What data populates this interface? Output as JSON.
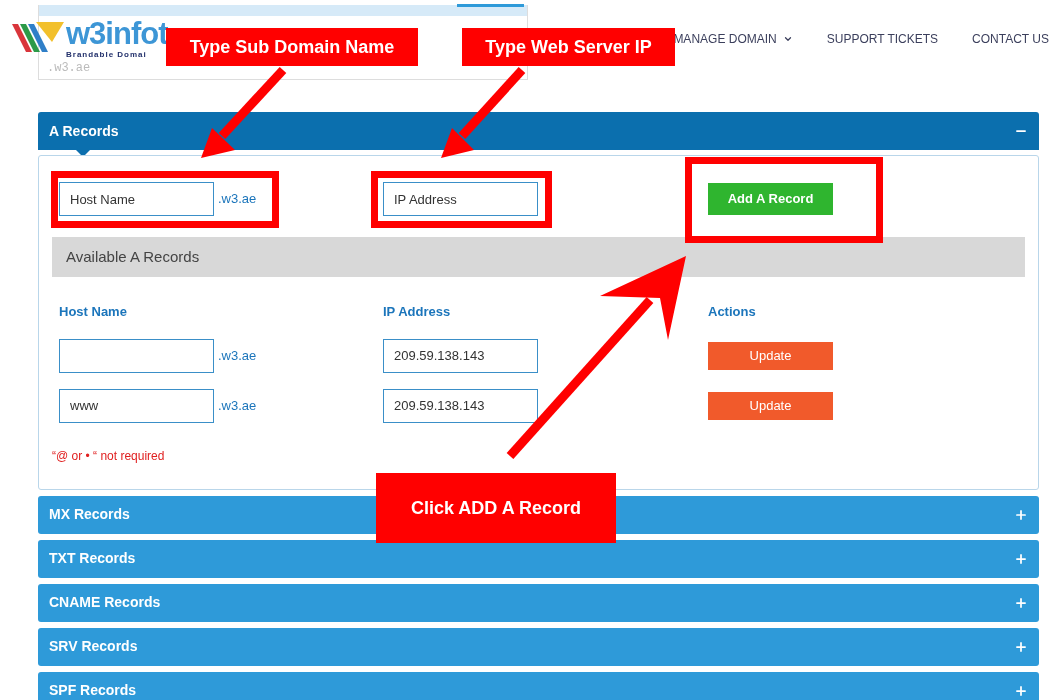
{
  "background_table": {
    "row": ".w3.ae"
  },
  "logo": {
    "name": "w3infot",
    "tagline": "Brandable Domai"
  },
  "nav": [
    {
      "label": "MANAGE DOMAIN",
      "has_menu": true
    },
    {
      "label": "SUPPORT TICKETS",
      "has_menu": false
    },
    {
      "label": "CONTACT US",
      "has_menu": false
    }
  ],
  "sections": [
    {
      "title": "A Records",
      "expanded": true
    },
    {
      "title": "MX Records",
      "expanded": false
    },
    {
      "title": "TXT Records",
      "expanded": false
    },
    {
      "title": "CNAME Records",
      "expanded": false
    },
    {
      "title": "SRV Records",
      "expanded": false
    },
    {
      "title": "SPF Records",
      "expanded": false
    }
  ],
  "a_records": {
    "new_record": {
      "host_placeholder": "Host Name",
      "suffix": ".w3.ae",
      "ip_placeholder": "IP Address",
      "add_button": "Add A Record"
    },
    "available_title": "Available A Records",
    "columns": [
      "Host Name",
      "IP Address",
      "Actions"
    ],
    "rows": [
      {
        "suffix": ".w3.ae",
        "ip": "209.59.138.143",
        "action": "Update"
      },
      {
        "host": "www",
        "suffix": ".w3.ae",
        "ip": "209.59.138.143",
        "action": "Update"
      }
    ],
    "note": "“@ or • “ not required"
  },
  "annotations": [
    {
      "text": "Type Sub Domain Name"
    },
    {
      "text": "Type Web Server IP"
    },
    {
      "text": "Click ADD A Record"
    }
  ]
}
